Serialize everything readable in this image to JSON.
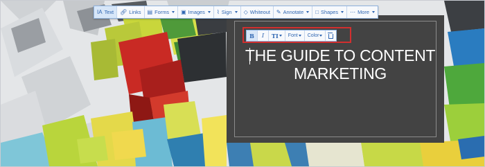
{
  "main_toolbar": {
    "items": [
      {
        "label": "Text",
        "icon": "text-icon"
      },
      {
        "label": "Links",
        "icon": "link-icon"
      },
      {
        "label": "Forms",
        "icon": "forms-icon",
        "dropdown": true
      },
      {
        "label": "Images",
        "icon": "image-icon",
        "dropdown": true
      },
      {
        "label": "Sign",
        "icon": "signature-icon",
        "dropdown": true
      },
      {
        "label": "Whiteout",
        "icon": "eraser-icon"
      },
      {
        "label": "Annotate",
        "icon": "pencil-icon",
        "dropdown": true
      },
      {
        "label": "Shapes",
        "icon": "shapes-icon",
        "dropdown": true
      },
      {
        "label": "More",
        "icon": "more-icon",
        "dropdown": true
      }
    ],
    "active_item": "Text"
  },
  "format_toolbar": {
    "bold_label": "B",
    "italic_label": "I",
    "size_label": "TI",
    "font_label": "Font",
    "color_label": "Color",
    "delete_icon": "trash-icon"
  },
  "document": {
    "headline_line1": "THE GUIDE TO CONTENT",
    "headline_line2": "MARKETING"
  },
  "colors": {
    "toolbar_accent": "#2f66b2",
    "highlight_border": "#d22f2f",
    "cover_background": "#434343"
  }
}
